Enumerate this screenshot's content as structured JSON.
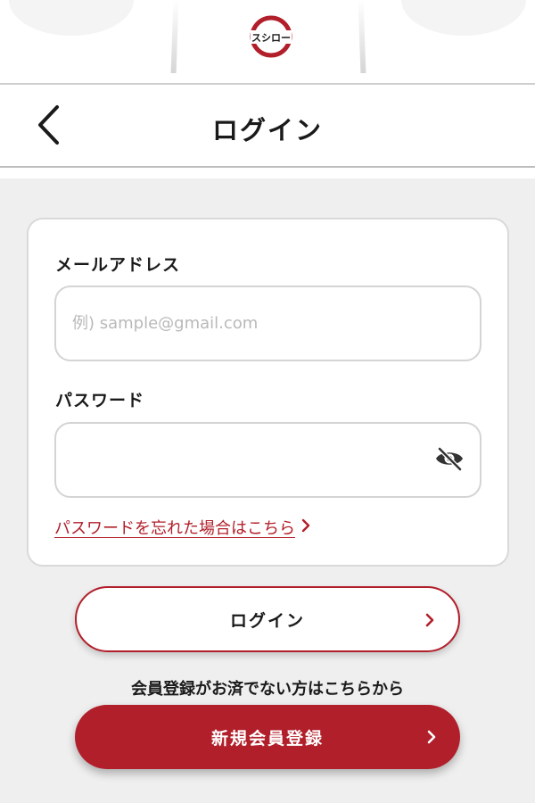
{
  "brand": {
    "logo_text": "スシロー",
    "accent_color": "#b11f2a"
  },
  "header": {
    "title": "ログイン",
    "back_icon": "chevron-left-icon"
  },
  "form": {
    "email": {
      "label": "メールアドレス",
      "placeholder": "例) sample@gmail.com",
      "value": ""
    },
    "password": {
      "label": "パスワード",
      "value": "",
      "toggle_icon": "eye-slash-icon"
    },
    "forgot_link": "パスワードを忘れた場合はこちら"
  },
  "actions": {
    "login_label": "ログイン",
    "register_note": "会員登録がお済でない方はこちらから",
    "register_label": "新規会員登録"
  }
}
